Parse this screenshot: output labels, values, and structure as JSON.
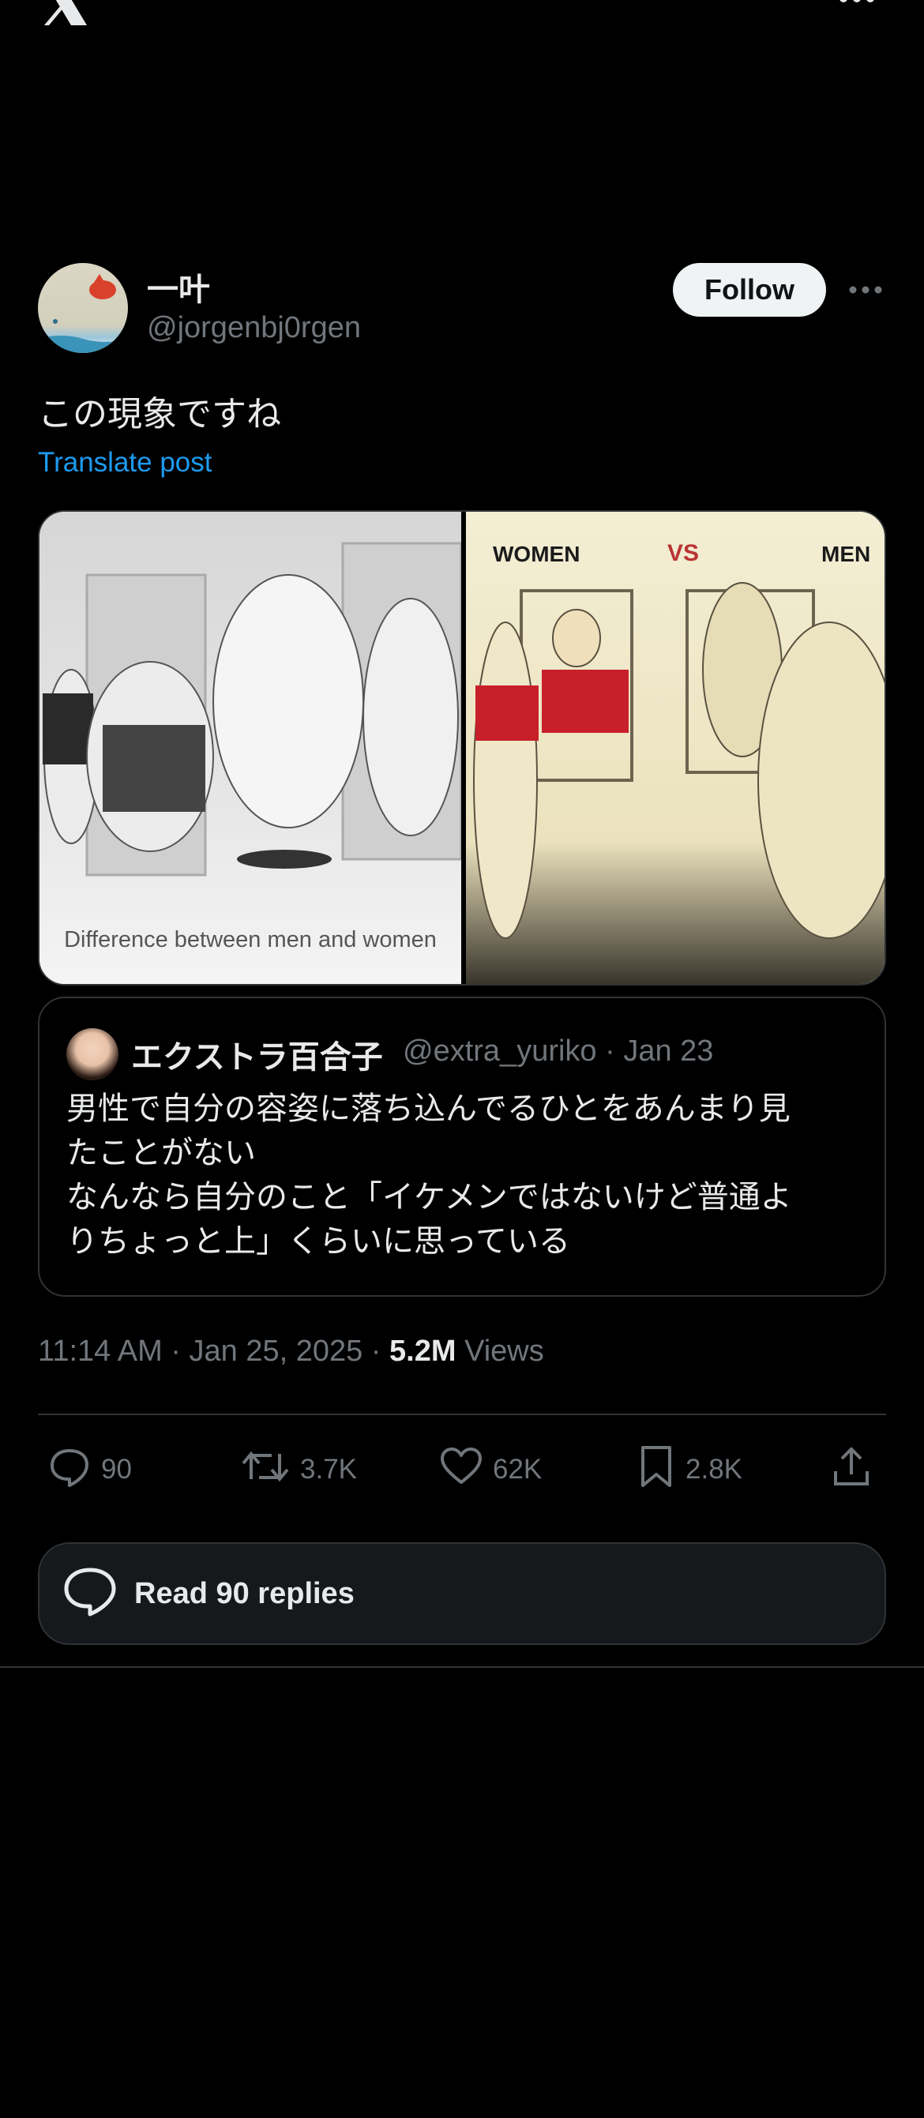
{
  "header": {
    "logo_icon": "x-logo-icon",
    "more_icon": "more-horizontal-icon"
  },
  "post": {
    "author_name": "一叶",
    "author_handle": "@jorgenbj0rgen",
    "follow_label": "Follow",
    "text": "この現象ですね",
    "translate_label": "Translate post",
    "media": {
      "left_caption": "Difference between men and women",
      "right_labels": {
        "women": "WOMEN",
        "vs": "VS",
        "men": "MEN"
      }
    },
    "quote": {
      "author_name": "エクストラ百合子",
      "author_handle": "@extra_yuriko",
      "date": "Jan 23",
      "handle_line": "@extra_yuriko · Jan 23",
      "text": "男性で自分の容姿に落ち込んでるひとをあんまり見\nたことがない\nなんなら自分のこと「イケメンではないけど普通よ\nりちょっと上」くらいに思っている"
    },
    "time": "11:14 AM · Jan 25, 2025 · ",
    "views_count": "5.2M",
    "views_label": "Views",
    "stats": {
      "replies": "90",
      "reposts": "3.7K",
      "likes": "62K",
      "bookmarks": "2.8K"
    },
    "read_replies_label": "Read 90 replies"
  },
  "colors": {
    "background": "#000000",
    "text_primary": "#e7e9ea",
    "text_secondary": "#71767b",
    "link": "#1d9bf0",
    "border": "#2f3336"
  }
}
